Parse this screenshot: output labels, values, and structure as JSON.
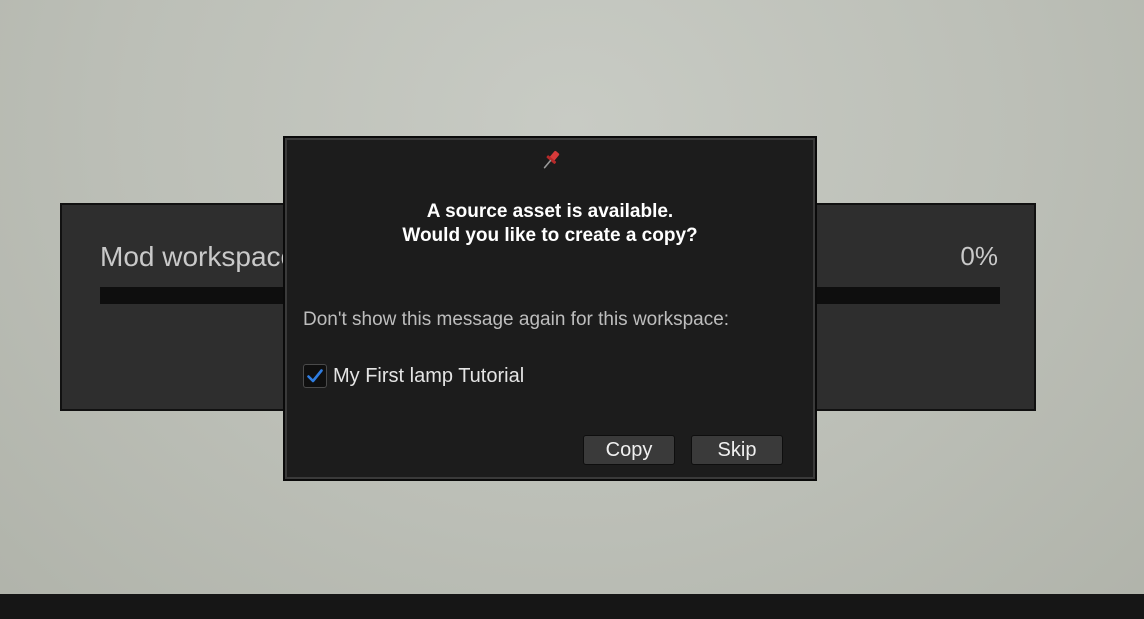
{
  "background_panel": {
    "title": "Mod workspace",
    "percent_text": "0%",
    "progress": 0
  },
  "dialog": {
    "icon": "pushpin-icon",
    "heading_line1": "A source asset is available.",
    "heading_line2": "Would you like to create a copy?",
    "dont_show_text": "Don't show this message again for this workspace:",
    "checkbox": {
      "label": "My First lamp Tutorial",
      "checked": true
    },
    "buttons": {
      "copy_label": "Copy",
      "skip_label": "Skip"
    }
  },
  "colors": {
    "accent": "#2f7de1",
    "pin_red": "#d63a3a",
    "dialog_bg": "#1c1c1c",
    "panel_bg": "#2e2e2e"
  }
}
